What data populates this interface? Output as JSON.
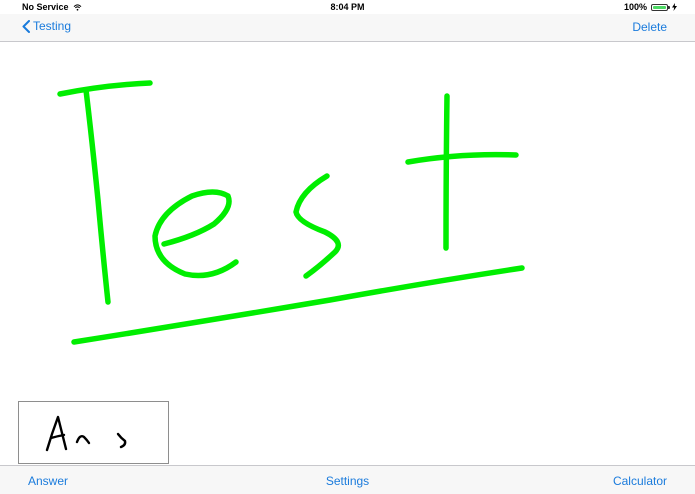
{
  "status_bar": {
    "carrier": "No Service",
    "time": "8:04 PM",
    "battery_percent": "100%",
    "battery_level": 1.0,
    "icons": [
      "wifi-icon",
      "battery-icon",
      "charging-bolt-icon"
    ]
  },
  "nav_bar": {
    "back_label": "Testing",
    "right_label": "Delete",
    "back_icon": "chevron-left-icon"
  },
  "drawing": {
    "ink_color": "#00ee00",
    "answer_ink_color": "#000000"
  },
  "tab_bar": {
    "answer_label": "Answer",
    "settings_label": "Settings",
    "calculator_label": "Calculator"
  },
  "colors": {
    "accent": "#1a7bdc",
    "battery": "#4cd964"
  }
}
